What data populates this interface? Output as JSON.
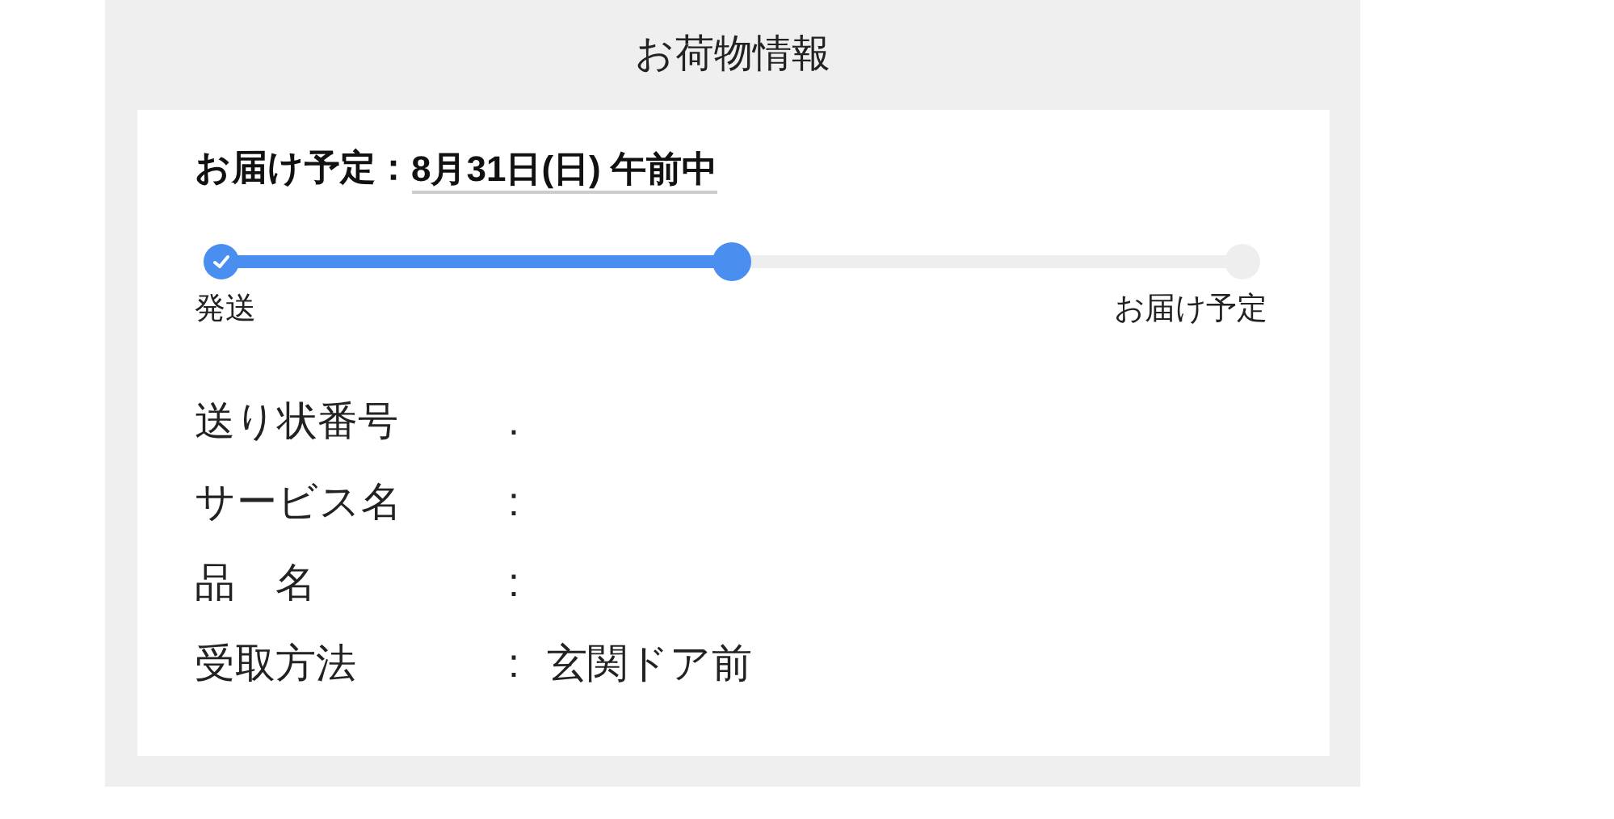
{
  "title": "お荷物情報",
  "delivery": {
    "label": "お届け予定：",
    "date": "8月31日(日) 午前中"
  },
  "progress": {
    "level": 0.5,
    "steps": [
      {
        "done": true,
        "current": false,
        "label": "発送"
      },
      {
        "done": false,
        "current": true
      },
      {
        "done": false,
        "current": false,
        "label": "お届け予定"
      }
    ]
  },
  "details": [
    {
      "label": "送り状番号",
      "separator": "."
    },
    {
      "label": "サービス名",
      "separator": ":"
    },
    {
      "label": "品　名",
      "separator": ":"
    },
    {
      "label": "受取方法",
      "separator": ":",
      "value": "玄関ドア前"
    }
  ]
}
